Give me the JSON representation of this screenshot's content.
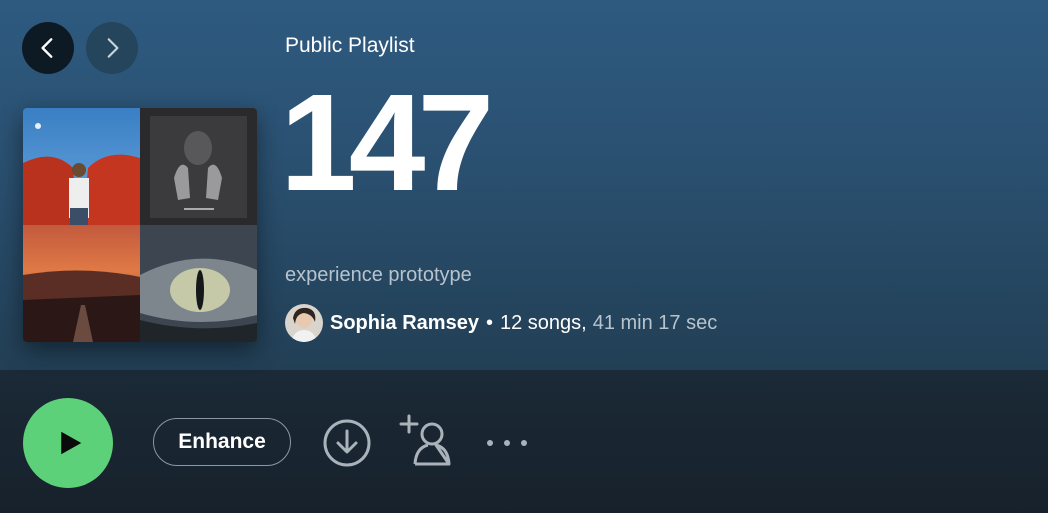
{
  "navigation": {
    "back_icon": "chevron-left-icon",
    "forward_icon": "chevron-right-icon"
  },
  "playlist": {
    "type_label": "Public Playlist",
    "title": "147",
    "description": "experience prototype",
    "owner": "Sophia Ramsey",
    "separator": "•",
    "song_count": "12 songs,",
    "duration": "41 min 17 sec",
    "cover_tiles": [
      "woman-red-cape-art",
      "hands-face-monochrome-art",
      "sunset-road-art",
      "reptile-eye-art"
    ]
  },
  "actions": {
    "play_icon": "play-icon",
    "enhance_label": "Enhance",
    "download_icon": "download-circle-icon",
    "add_user_icon": "add-user-icon",
    "more_icon": "more-horizontal-icon"
  },
  "colors": {
    "play_green": "#5cd17a",
    "header_gradient_top": "#2e5a80",
    "background_dark": "#17212b",
    "muted_text": "#b7c3cd"
  }
}
